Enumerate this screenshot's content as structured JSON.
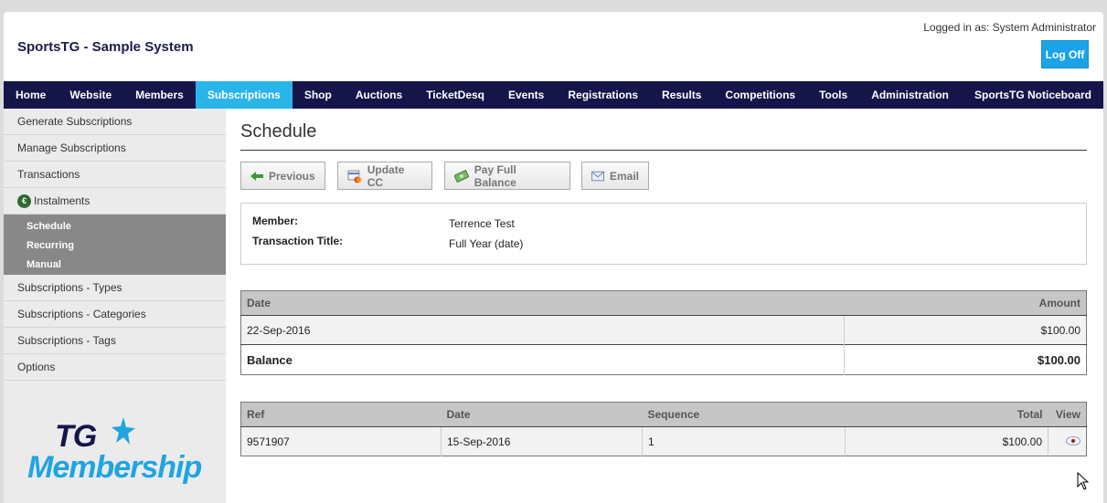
{
  "app": {
    "title": "SportsTG - Sample System"
  },
  "user": {
    "logged_in_label": "Logged in as: System Administrator",
    "logoff_label": "Log Off"
  },
  "nav": {
    "items": [
      "Home",
      "Website",
      "Members",
      "Subscriptions",
      "Shop",
      "Auctions",
      "TicketDesq",
      "Events",
      "Registrations",
      "Results",
      "Competitions",
      "Tools",
      "Administration"
    ],
    "active": "Subscriptions",
    "right_item": "SportsTG Noticeboard"
  },
  "sidebar": {
    "items_top": [
      "Generate Subscriptions",
      "Manage Subscriptions",
      "Transactions"
    ],
    "instalments_label": "Instalments",
    "instalments_badge": "€",
    "sub_items": [
      "Schedule",
      "Recurring",
      "Manual"
    ],
    "items_bottom": [
      "Subscriptions - Types",
      "Subscriptions - Categories",
      "Subscriptions - Tags",
      "Options"
    ]
  },
  "brand": {
    "line1": "TG",
    "line2": "Membership"
  },
  "page": {
    "title": "Schedule",
    "buttons": {
      "previous": "Previous",
      "update_cc": "Update CC",
      "pay_full": "Pay Full Balance",
      "email": "Email"
    }
  },
  "info": {
    "member_label": "Member:",
    "member_value": "Terrence Test",
    "title_label": "Transaction Title:",
    "title_value": "Full Year (date)"
  },
  "schedule_table": {
    "headers": {
      "date": "Date",
      "amount": "Amount"
    },
    "rows": [
      {
        "date": "22-Sep-2016",
        "amount": "$100.00"
      }
    ],
    "balance_label": "Balance",
    "balance_value": "$100.00"
  },
  "payments_table": {
    "headers": {
      "ref": "Ref",
      "date": "Date",
      "sequence": "Sequence",
      "total": "Total",
      "view": "View"
    },
    "rows": [
      {
        "ref": "9571907",
        "date": "15-Sep-2016",
        "sequence": "1",
        "total": "$100.00"
      }
    ]
  },
  "colors": {
    "nav_bg": "#14164a",
    "nav_active": "#2ab5e8",
    "logoff": "#1aa3e6",
    "brand_blue": "#1fa5e0"
  }
}
